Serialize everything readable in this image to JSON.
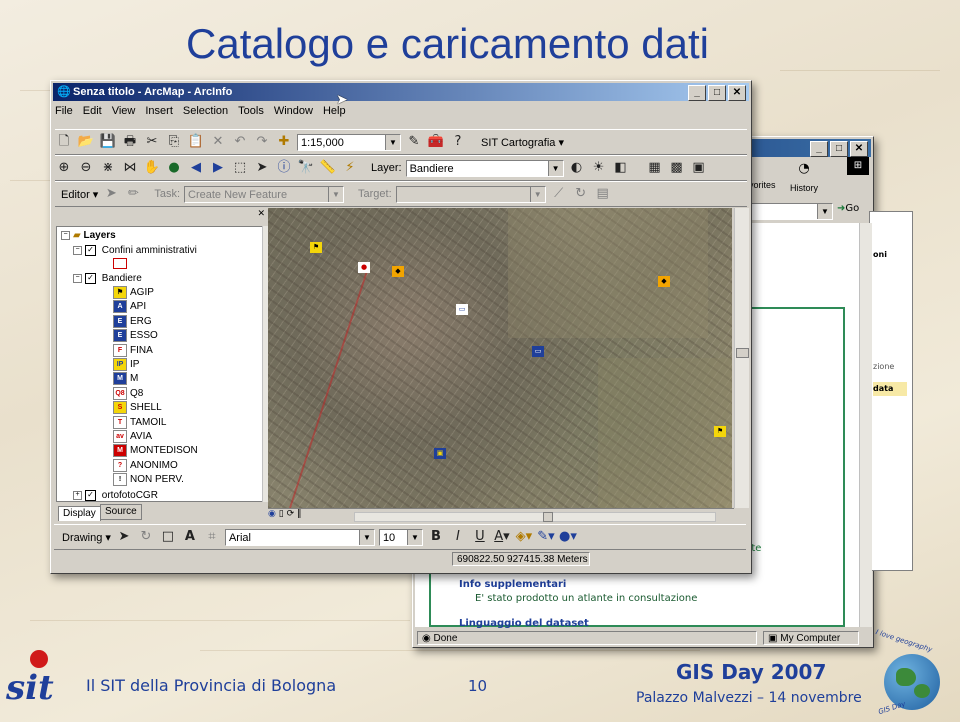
{
  "slide": {
    "title": "Catalogo e caricamento dati",
    "footer_left": "Il SIT della Provincia di Bologna",
    "page_number": "10",
    "event": "GIS Day 2007",
    "footer_right": "Palazzo Malvezzi – 14 novembre",
    "logo_left": "sit",
    "logo_right_text": "I love geography",
    "logo_right_sub": "GIS Day"
  },
  "arcmap": {
    "title": "Senza titolo - ArcMap - ArcInfo",
    "menus": [
      "File",
      "Edit",
      "View",
      "Insert",
      "Selection",
      "Tools",
      "Window",
      "Help"
    ],
    "scale": "1:15,000",
    "sit_menu": "SIT Cartografia",
    "layer_label": "Layer:",
    "layer_value": "Bandiere",
    "editor_label": "Editor",
    "task_label": "Task:",
    "task_value": "Create New Feature",
    "target_label": "Target:",
    "drawing_label": "Drawing",
    "font_name": "Arial",
    "font_size": "10",
    "bold": "B",
    "italic": "I",
    "underline": "U",
    "coordinates": "690822.50  927415.38 Meters",
    "tabs": [
      "Display",
      "Source"
    ],
    "toc": {
      "root": "Layers",
      "group1": "Confini amministrativi",
      "group2": "Bandiere",
      "items": [
        "AGIP",
        "API",
        "ERG",
        "ESSO",
        "FINA",
        "IP",
        "M",
        "Q8",
        "SHELL",
        "TAMOIL",
        "AVIA",
        "MONTEDISON",
        "ANONIMO",
        "NON PERV."
      ],
      "group3": "ortofotoCGR"
    }
  },
  "browser": {
    "toolbar_favorites": "vorites",
    "toolbar_history": "History",
    "go": "Go",
    "section1_title": "Info supplementari",
    "section1_text": "E' stato prodotto un atlante in consultazione",
    "section2_title": "Linguaggio del dataset",
    "fragment_nte": "nte",
    "fragment_zione": "zione",
    "fragment_data": "data",
    "fragment_oni": "oni",
    "status_done": "Done",
    "status_zone": "My Computer"
  },
  "colors": {
    "title_blue": "#1f3f9a",
    "titlebar_start": "#0a246a",
    "titlebar_end": "#a6caf0",
    "browser_green": "#1a7a3a"
  }
}
